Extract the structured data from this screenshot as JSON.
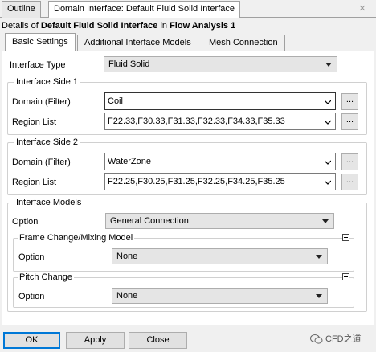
{
  "window": {
    "tabs": [
      {
        "label": "Outline"
      },
      {
        "label": "Domain Interface: Default Fluid Solid Interface"
      }
    ],
    "close_glyph": "✕"
  },
  "details": {
    "prefix": "Details of ",
    "object": "Default Fluid Solid Interface",
    "middle": " in ",
    "container": "Flow Analysis 1"
  },
  "tabs": [
    {
      "label": "Basic Settings"
    },
    {
      "label": "Additional Interface Models"
    },
    {
      "label": "Mesh Connection"
    }
  ],
  "form": {
    "interface_type": {
      "label": "Interface Type",
      "value": "Fluid Solid"
    },
    "side1": {
      "title": "Interface Side 1",
      "domain_label": "Domain (Filter)",
      "domain_value": "Coil",
      "region_label": "Region List",
      "region_value": "F22.33,F30.33,F31.33,F32.33,F34.33,F35.33"
    },
    "side2": {
      "title": "Interface Side 2",
      "domain_label": "Domain (Filter)",
      "domain_value": "WaterZone",
      "region_label": "Region List",
      "region_value": "F22.25,F30.25,F31.25,F32.25,F34.25,F35.25"
    },
    "models": {
      "title": "Interface Models",
      "option_label": "Option",
      "option_value": "General Connection",
      "frame_change": {
        "title": "Frame Change/Mixing Model",
        "option_label": "Option",
        "option_value": "None"
      },
      "pitch_change": {
        "title": "Pitch Change",
        "option_label": "Option",
        "option_value": "None"
      }
    },
    "dots_label": "..."
  },
  "buttons": {
    "ok": "OK",
    "apply": "Apply",
    "close": "Close"
  },
  "watermark": {
    "text": "CFD之道"
  }
}
